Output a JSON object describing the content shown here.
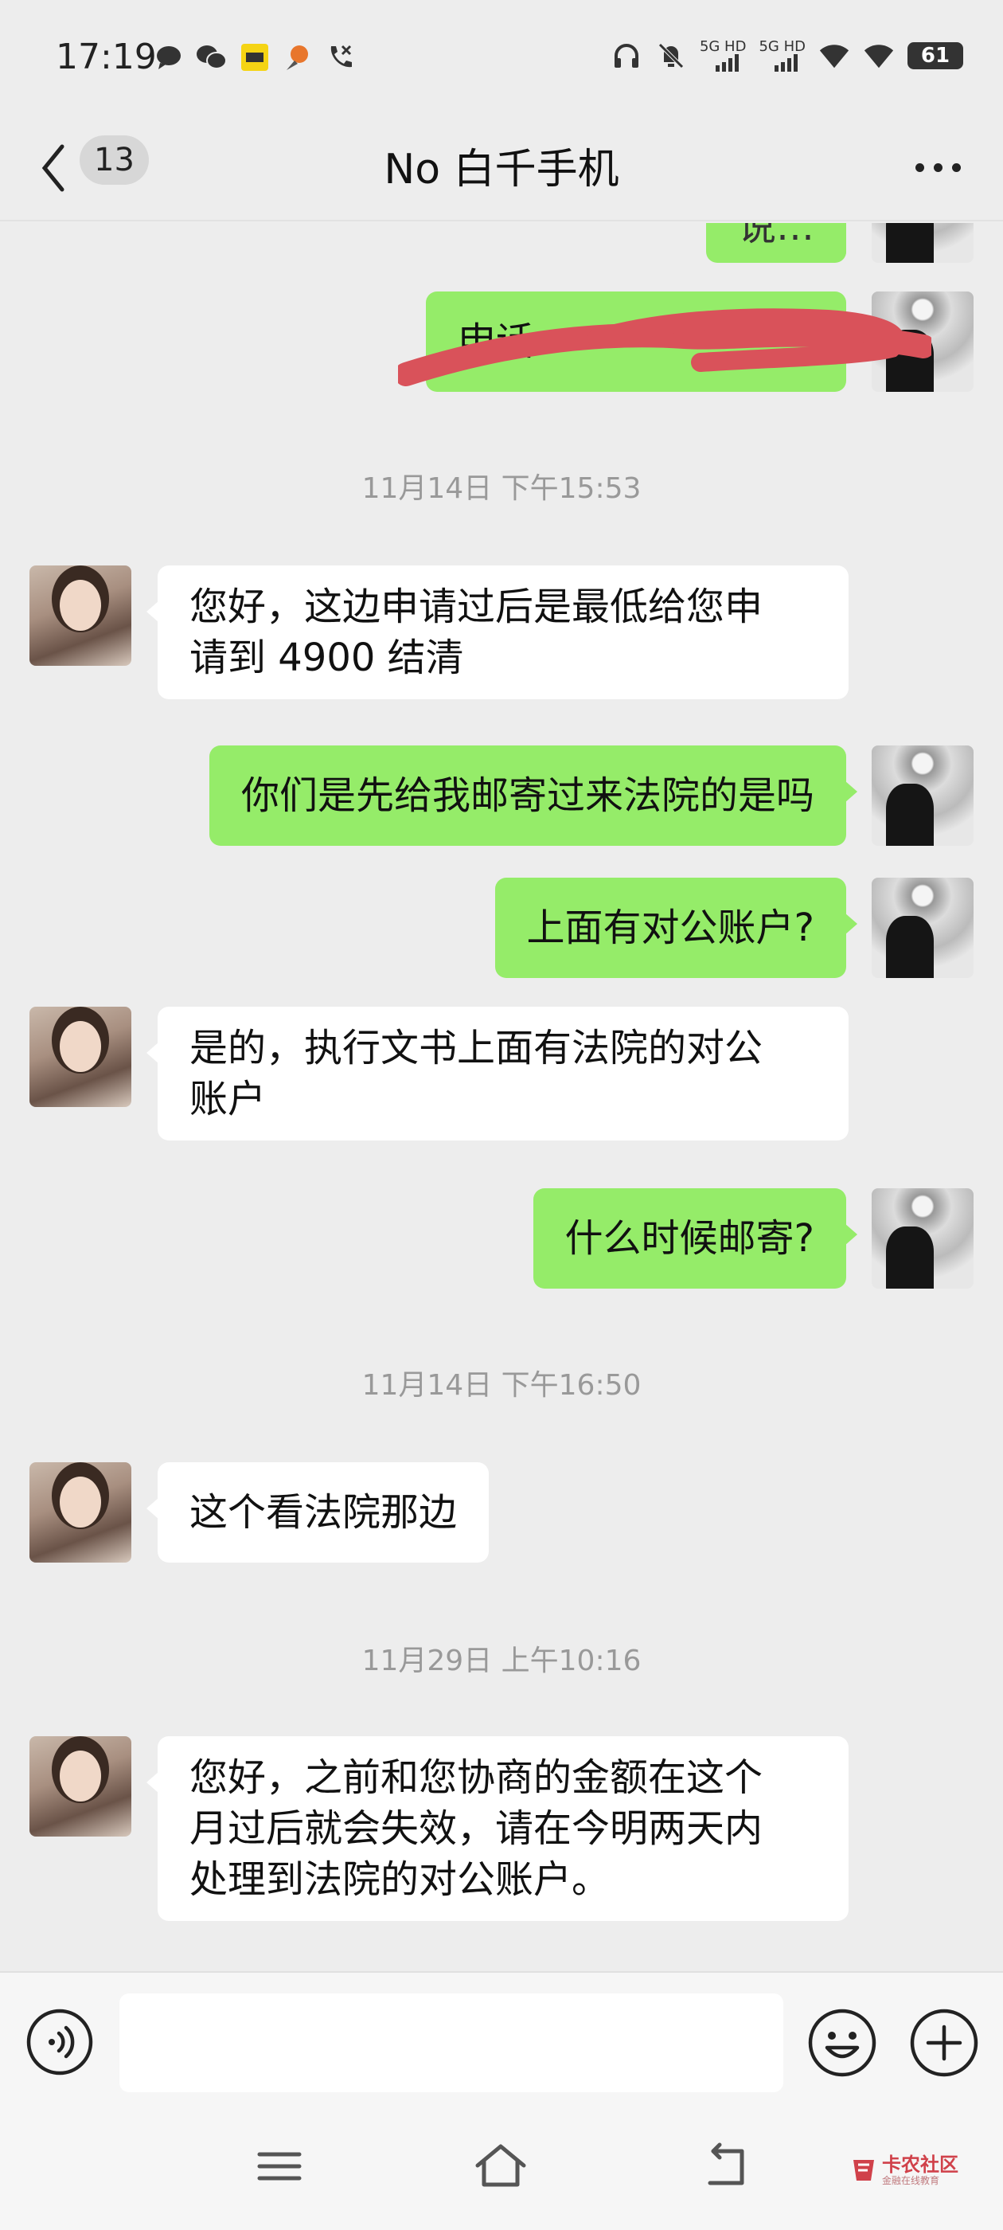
{
  "status_bar": {
    "time": "17:19",
    "net1": "5G HD",
    "net2": "5G HD",
    "battery": "61"
  },
  "header": {
    "back_count": "13",
    "title": "No 白千手机"
  },
  "messages": {
    "m0_partial": "说…",
    "m1_redacted_prefix": "申话",
    "ts1": "11月14日 下午15:53",
    "m2": [
      "您好，这边申请过后是最低给您申",
      "请到 4900 结清"
    ],
    "m3": "你们是先给我邮寄过来法院的是吗",
    "m4": "上面有对公账户?",
    "m5": [
      "是的，执行文书上面有法院的对公",
      "账户"
    ],
    "m6": "什么时候邮寄?",
    "ts2": "11月14日 下午16:50",
    "m7": "这个看法院那边",
    "ts3": "11月29日 上午10:16",
    "m8": [
      "您好，之前和您协商的金额在这个",
      "月过后就会失效，请在今明两天内",
      "处理到法院的对公账户。"
    ]
  },
  "input": {
    "placeholder": ""
  },
  "watermark": {
    "title": "卡农社区",
    "subtitle": "金融在线教育"
  },
  "colors": {
    "self_bubble": "#95ec69",
    "other_bubble": "#ffffff",
    "background": "#ededed",
    "redaction": "#d9525a"
  }
}
